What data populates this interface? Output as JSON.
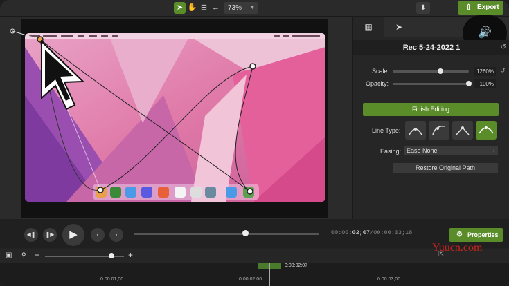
{
  "toolbar": {
    "tools": [
      "arrow-select",
      "hand-pan",
      "crop",
      "fit-resize"
    ],
    "zoom_value": "73%",
    "export_label": "Export"
  },
  "panel": {
    "tabs": [
      "media-tab",
      "cursor-tab"
    ],
    "title": "Rec 5-24-2022 1",
    "scale_label": "Scale:",
    "scale_value": "1260%",
    "scale_fraction": 0.63,
    "opacity_label": "Opacity:",
    "opacity_value": "100%",
    "opacity_fraction": 1.0,
    "finish_label": "Finish Editing",
    "line_type_label": "Line Type:",
    "line_types_selected_index": 3,
    "easing_label": "Easing:",
    "easing_value": "Ease None",
    "restore_label": "Restore Original Path"
  },
  "playback": {
    "progress_fraction": 0.6,
    "timecode_dim_prefix": "00:00:",
    "timecode_current": "02;07",
    "timecode_total": "/00:00:03;18",
    "properties_label": "Properties"
  },
  "timeline": {
    "zoom_fraction": 0.84,
    "ruler_labels": [
      "0:00:01;00",
      "0:00:02;00",
      "0:00:03;00"
    ],
    "playhead_label": "0:00:02;07"
  },
  "watermark": "Yuucn.com",
  "colors": {
    "accent_green": "#5b8c2a",
    "wallpaper_pink": "#e07aa8",
    "wallpaper_purple": "#9a4fb0"
  }
}
